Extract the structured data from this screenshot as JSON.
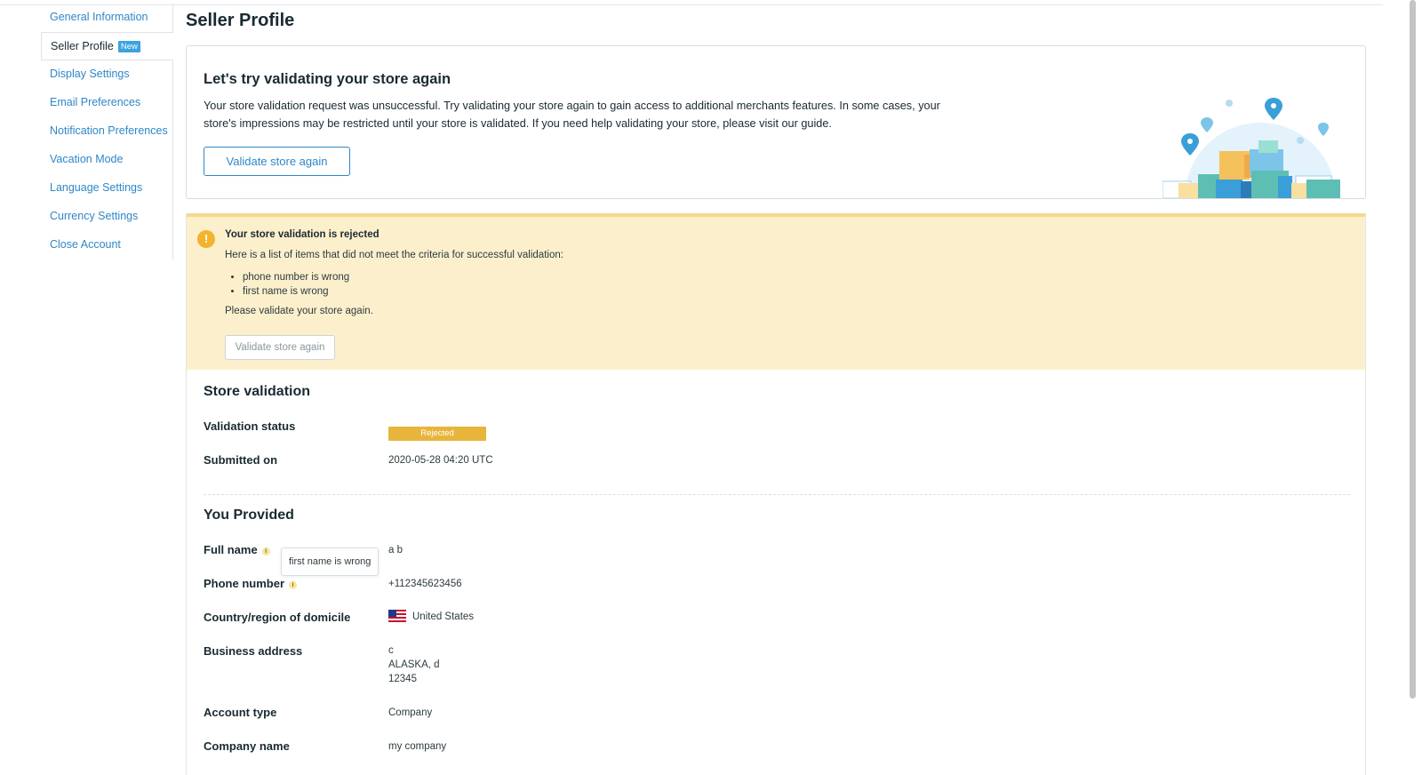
{
  "sidebar": {
    "items": [
      {
        "label": "General Information"
      },
      {
        "label": "Seller Profile",
        "badge": "New"
      },
      {
        "label": "Display Settings"
      },
      {
        "label": "Email Preferences"
      },
      {
        "label": "Notification Preferences"
      },
      {
        "label": "Vacation Mode"
      },
      {
        "label": "Language Settings"
      },
      {
        "label": "Currency Settings"
      },
      {
        "label": "Close Account"
      }
    ]
  },
  "page": {
    "title": "Seller Profile"
  },
  "retry_card": {
    "title": "Let's try validating your store again",
    "description": "Your store validation request was unsuccessful. Try validating your store again to gain access to additional merchants features. In some cases, your store's impressions may be restricted until your store is validated. If you need help validating your store, please visit our guide.",
    "button_label": "Validate store again"
  },
  "rejection_notice": {
    "icon": "!",
    "title": "Your store validation is rejected",
    "intro": "Here is a list of items that did not meet the criteria for successful validation:",
    "items": [
      "phone number is wrong",
      "first name is wrong"
    ],
    "footer": "Please validate your store again.",
    "button_label": "Validate store again"
  },
  "store_validation": {
    "title": "Store validation",
    "status_label": "Validation status",
    "status_value": "Rejected",
    "submitted_label": "Submitted on",
    "submitted_value": "2020-05-28 04:20 UTC"
  },
  "provided": {
    "title": "You Provided",
    "info_icon": "i",
    "full_name_label": "Full name",
    "full_name_tooltip": "first name is wrong",
    "full_name_value": "a b",
    "phone_label": "Phone number",
    "phone_value": "+112345623456",
    "country_label": "Country/region of domicile",
    "country_value": "United States",
    "address_label": "Business address",
    "address_lines": [
      "c",
      "ALASKA, d",
      "12345"
    ],
    "account_type_label": "Account type",
    "account_type_value": "Company",
    "company_label": "Company name",
    "company_value": "my company"
  },
  "colors": {
    "link": "#2f87c7",
    "warning_bg": "#fcf0cc",
    "warning_icon": "#f2b32f",
    "rejected_badge": "#e8b53c"
  }
}
